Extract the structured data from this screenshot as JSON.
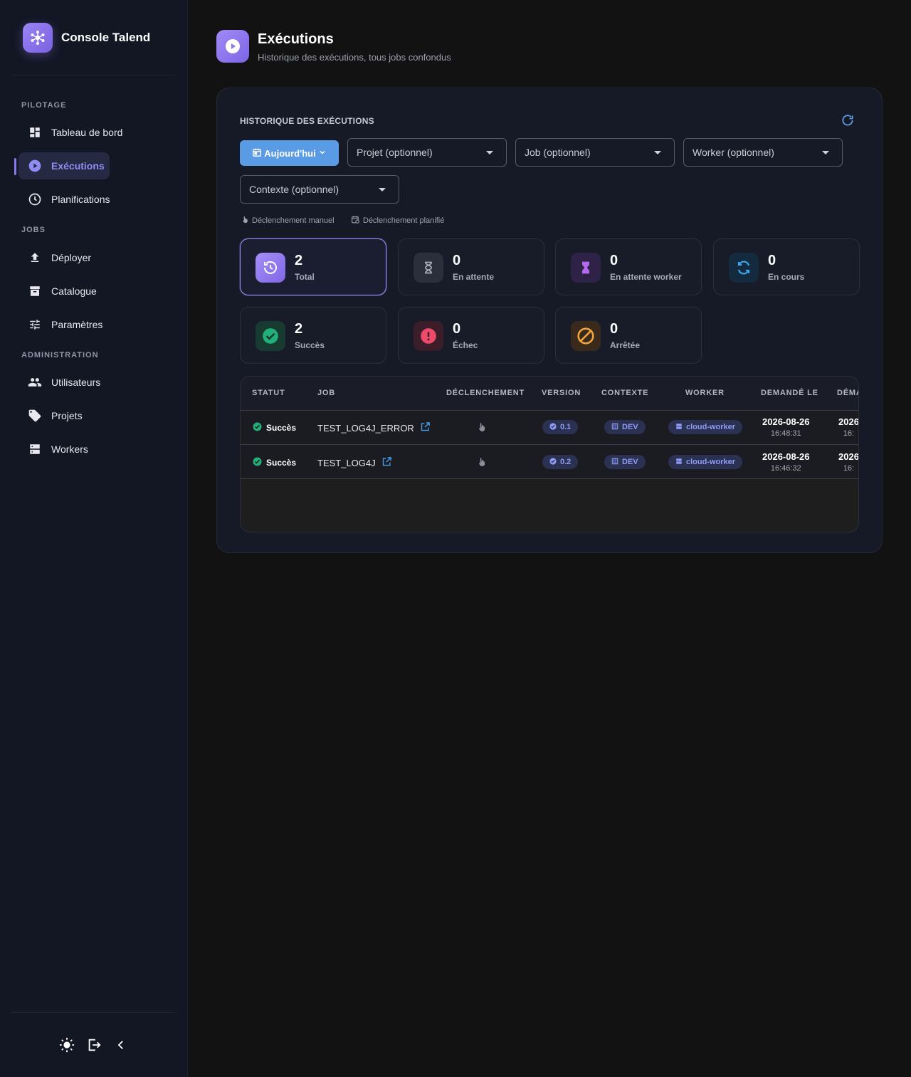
{
  "app": {
    "name": "Console Talend"
  },
  "sidebar": {
    "sections": {
      "pilotage": "PILOTAGE",
      "jobs": "JOBS",
      "admin": "ADMINISTRATION"
    },
    "items": [
      {
        "label": "Tableau de bord",
        "icon": "dashboard-icon"
      },
      {
        "label": "Exécutions",
        "icon": "play-circle-icon",
        "active": true
      },
      {
        "label": "Planifications",
        "icon": "clock-icon"
      },
      {
        "label": "Déployer",
        "icon": "upload-icon"
      },
      {
        "label": "Catalogue",
        "icon": "archive-icon"
      },
      {
        "label": "Paramètres",
        "icon": "sliders-icon"
      },
      {
        "label": "Utilisateurs",
        "icon": "users-icon"
      },
      {
        "label": "Projets",
        "icon": "tag-icon"
      },
      {
        "label": "Workers",
        "icon": "server-icon"
      }
    ]
  },
  "header": {
    "title": "Exécutions",
    "subtitle": "Historique des exécutions, tous jobs confondus"
  },
  "history": {
    "title": "HISTORIQUE DES EXÉCUTIONS",
    "filters": {
      "date": "Aujourd'hui",
      "projet": "Projet (optionnel)",
      "job": "Job (optionnel)",
      "worker": "Worker (optionnel)",
      "contexte": "Contexte (optionnel)"
    },
    "legend": {
      "manual": "Déclenchement manuel",
      "scheduled": "Déclenchement planifié"
    },
    "stats": [
      {
        "value": "2",
        "label": "Total"
      },
      {
        "value": "0",
        "label": "En attente"
      },
      {
        "value": "0",
        "label": "En attente worker"
      },
      {
        "value": "0",
        "label": "En cours"
      },
      {
        "value": "2",
        "label": "Succès"
      },
      {
        "value": "0",
        "label": "Échec"
      },
      {
        "value": "0",
        "label": "Arrêtée"
      }
    ],
    "columns": [
      "STATUT",
      "JOB",
      "DÉCLENCHEMENT",
      "VERSION",
      "CONTEXTE",
      "WORKER",
      "DEMANDÉ LE",
      "DÉMA"
    ],
    "rows": [
      {
        "status": "Succès",
        "job": "TEST_LOG4J_ERROR",
        "version": "0.1",
        "context": "DEV",
        "worker": "cloud-worker",
        "requested_date": "2026-08-26",
        "requested_time": "16:48:31",
        "started_date": "2026",
        "started_time": "16:"
      },
      {
        "status": "Succès",
        "job": "TEST_LOG4J",
        "version": "0.2",
        "context": "DEV",
        "worker": "cloud-worker",
        "requested_date": "2026-08-26",
        "requested_time": "16:46:32",
        "started_date": "2026",
        "started_time": "16:"
      }
    ]
  },
  "colors": {
    "accent": "#8b78f0",
    "primary_button": "#5a9be6",
    "success": "#22b07a",
    "danger": "#f04a6a",
    "warning": "#f2a33a"
  }
}
